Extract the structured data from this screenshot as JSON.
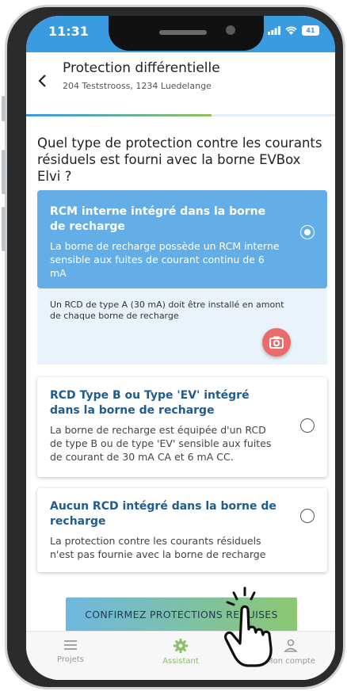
{
  "status_bar": {
    "time": "11:31",
    "battery": "41"
  },
  "header": {
    "back_icon": "chevron-left-icon",
    "title": "Protection différentielle",
    "subtitle": "204 Teststrooss, 1234 Luedelange"
  },
  "progress": {
    "fraction": 0.6
  },
  "question": "Quel type de protection contre les courants résiduels est fourni avec la borne EVBox Elvi ?",
  "options": [
    {
      "title": "RCM interne intégré dans la borne de recharge",
      "description": "La borne de recharge possède un RCM interne sensible aux fuites de courant continu de 6 mA",
      "selected": true
    },
    {
      "title": "RCD Type B ou Type 'EV' intégré dans la borne de recharge",
      "description": "La borne de recharge est équipée d'un RCD de type B ou de type 'EV' sensible aux fuites de courant de 30 mA CA et 6 mA CC.",
      "selected": false
    },
    {
      "title": "Aucun RCD intégré dans la borne de recharge",
      "description": "La protection contre les courants résiduels n'est pas fournie avec la borne de recharge",
      "selected": false
    }
  ],
  "notice": {
    "text": "Un RCD de type A (30 mA) doit être installé en amont de chaque borne de recharge",
    "camera_icon": "camera-icon"
  },
  "confirm_button": "CONFIRMEZ PROTECTIONS REQUISES",
  "bottom_nav": [
    {
      "label": "Projets",
      "icon": "menu-icon",
      "active": false
    },
    {
      "label": "Assistant",
      "icon": "gear-icon",
      "active": true
    },
    {
      "label": "Mon compte",
      "icon": "user-icon",
      "active": false
    }
  ],
  "colors": {
    "primary": "#3a9be0",
    "selected_card": "#63aee6",
    "camera_button": "#ea6b6b",
    "accent_green": "#8bbf6a"
  }
}
